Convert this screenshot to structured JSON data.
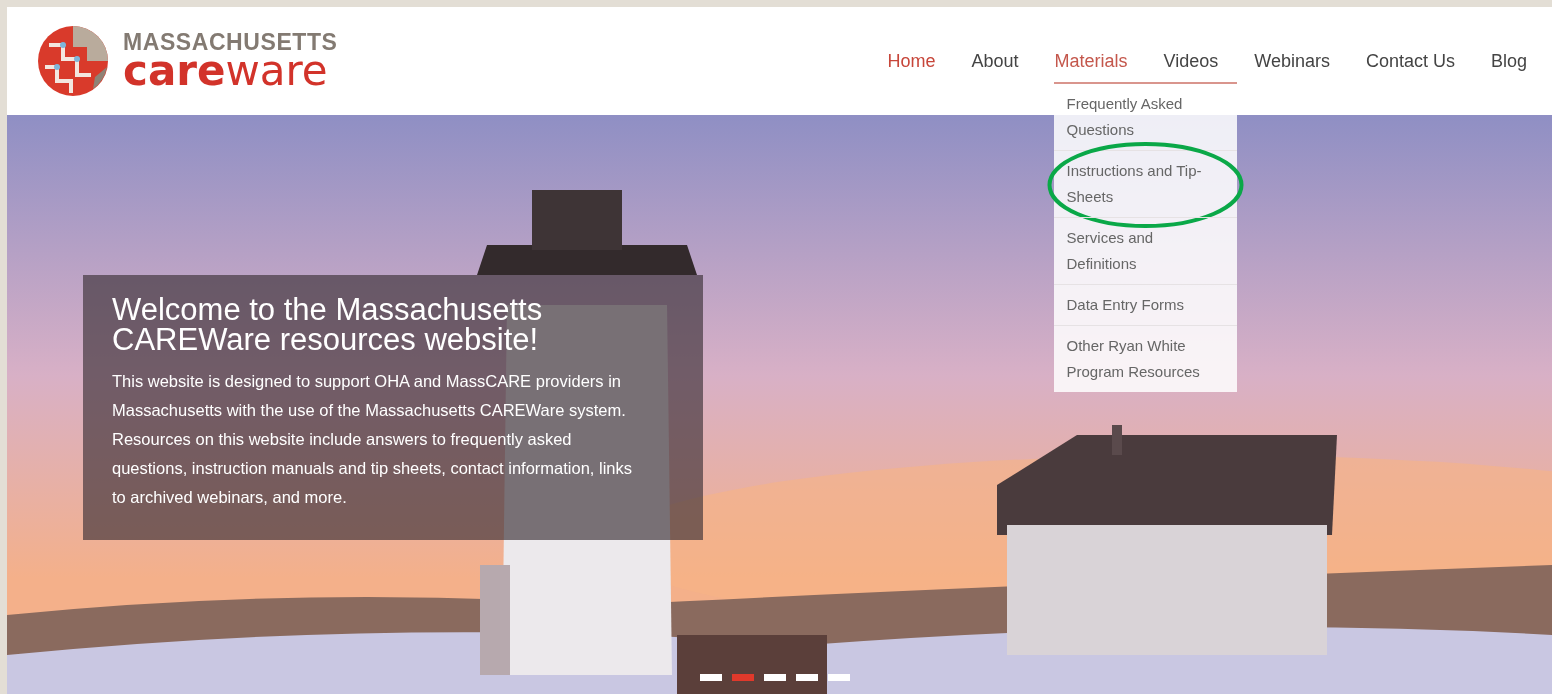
{
  "logo": {
    "line1": "MASSACHUSETTS",
    "line2": "**care**ware"
  },
  "nav": [
    {
      "label": "Home",
      "selected": true,
      "expanded": false
    },
    {
      "label": "About",
      "selected": false,
      "expanded": false
    },
    {
      "label": "Materials",
      "selected": false,
      "expanded": true,
      "menu": [
        {
          "label": "Frequently Asked Questions",
          "circled": false
        },
        {
          "label": "Instructions and Tip-Sheets",
          "circled": true
        },
        {
          "label": "Services and Definitions",
          "circled": false
        },
        {
          "label": "Data Entry Forms",
          "circled": false
        },
        {
          "label": "Other Ryan White Program Resources",
          "circled": false
        }
      ]
    },
    {
      "label": "Videos",
      "selected": false,
      "expanded": false
    },
    {
      "label": "Webinars",
      "selected": false,
      "expanded": false
    },
    {
      "label": "Contact Us",
      "selected": false,
      "expanded": false
    },
    {
      "label": "Blog",
      "selected": false,
      "expanded": false
    }
  ],
  "hero": {
    "title": "Welcome to the Massachusetts CAREWare resources website!",
    "text": "This website is designed to support OHA and MassCARE providers in Massachusetts with the use of the Massachusetts CAREWare system. Resources on this website include answers to frequently asked questions, instruction manuals and tip sheets, contact information, links to archived webinars, and more."
  },
  "slides": [
    {
      "selected": false
    },
    {
      "selected": true
    },
    {
      "selected": false
    },
    {
      "selected": false
    },
    {
      "selected": false
    }
  ]
}
